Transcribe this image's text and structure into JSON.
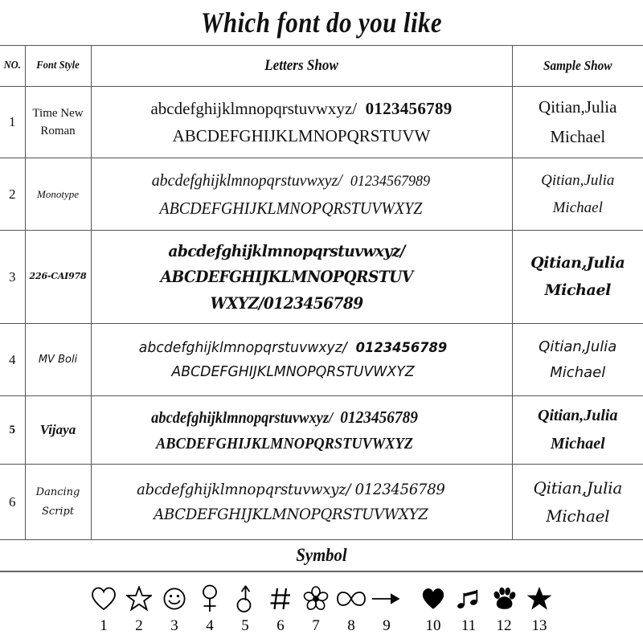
{
  "title": "Which font do you like",
  "table": {
    "headers": {
      "no": "NO.",
      "font_style": "Font Style",
      "letters_show": "Letters Show",
      "sample_show": "Sample Show"
    },
    "rows": [
      {
        "no": "1",
        "style_line1": "Time New",
        "style_line2": "Roman",
        "letters_line1_alpha": "abcdefghijklmnopqrstuvwxyz/",
        "letters_line1_nums": "0123456789",
        "letters_line2": "ABCDEFGHIJKLMNOPQRSTUVW",
        "letters_line3": "",
        "sample_line1": "Qitian,Julia",
        "sample_line2": "Michael"
      },
      {
        "no": "2",
        "style_line1": "Monotype",
        "style_line2": "",
        "letters_line1_alpha": "abcdefghijklmnopqrstuvwxyz/",
        "letters_line1_nums": "01234567989",
        "letters_line2": "ABCDEFGHIJKLMNOPQRSTUVWXYZ",
        "letters_line3": "",
        "sample_line1": "Qitian,Julia",
        "sample_line2": "Michael"
      },
      {
        "no": "3",
        "style_line1": "226-CAI978",
        "style_line2": "",
        "letters_line1_alpha": "abcdefghijklmnopqrstuvwxyz/",
        "letters_line1_nums": "",
        "letters_line2": "ABCDEFGHIJKLMNOPQRSTUV",
        "letters_line3": "WXYZ/0123456789",
        "sample_line1": "Qitian,Julia",
        "sample_line2": "Michael"
      },
      {
        "no": "4",
        "style_line1": "MV Boli",
        "style_line2": "",
        "letters_line1_alpha": "abcdefghijklmnopqrstuvwxyz/",
        "letters_line1_nums": "0123456789",
        "letters_line2": "ABCDEFGHIJKLMNOPQRSTUVWXYZ",
        "letters_line3": "",
        "sample_line1": "Qitian,Julia",
        "sample_line2": "Michael"
      },
      {
        "no": "5",
        "style_line1": "Vijaya",
        "style_line2": "",
        "letters_line1_alpha": "abcdefghijklmnopqrstuvwxyz/",
        "letters_line1_nums": "0123456789",
        "letters_line2": "ABCDEFGHIJKLMNOPQRSTUVWXYZ",
        "letters_line3": "",
        "sample_line1": "Qitian,Julia",
        "sample_line2": "Michael"
      },
      {
        "no": "6",
        "style_line1": "Dancing",
        "style_line2": "Script",
        "letters_line1_alpha": "abcdefghijklmnopqrstuvwxyz/",
        "letters_line1_nums": "0123456789",
        "letters_line2": "ABCDEFGHIJKLMNOPQRSTUVWXYZ",
        "letters_line3": "",
        "sample_line1": "Qitian,Julia",
        "sample_line2": "Michael"
      }
    ]
  },
  "symbol_section": {
    "heading": "Symbol",
    "symbols": [
      {
        "num": "1",
        "icon": "heart-outline-icon",
        "glyph": "♡"
      },
      {
        "num": "2",
        "icon": "star-outline-icon",
        "glyph": "☆"
      },
      {
        "num": "3",
        "icon": "smiley-face-icon",
        "glyph": "☺"
      },
      {
        "num": "4",
        "icon": "female-symbol-icon",
        "glyph": "♀"
      },
      {
        "num": "5",
        "icon": "male-symbol-icon",
        "glyph": "♂"
      },
      {
        "num": "6",
        "icon": "hash-icon",
        "glyph": "#"
      },
      {
        "num": "7",
        "icon": "flower-icon",
        "glyph": "✿"
      },
      {
        "num": "8",
        "icon": "infinity-icon",
        "glyph": "∞"
      },
      {
        "num": "9",
        "icon": "arrow-right-icon",
        "glyph": "→"
      },
      {
        "num": "10",
        "icon": "heart-filled-icon",
        "glyph": "♥"
      },
      {
        "num": "11",
        "icon": "music-note-icon",
        "glyph": "♫"
      },
      {
        "num": "12",
        "icon": "paw-print-icon",
        "glyph": "ὃE"
      },
      {
        "num": "13",
        "icon": "star-filled-icon",
        "glyph": "★"
      }
    ]
  },
  "colors": {
    "background": "#ffffff",
    "text": "#111111",
    "border": "#555555",
    "rule": "#666666"
  }
}
